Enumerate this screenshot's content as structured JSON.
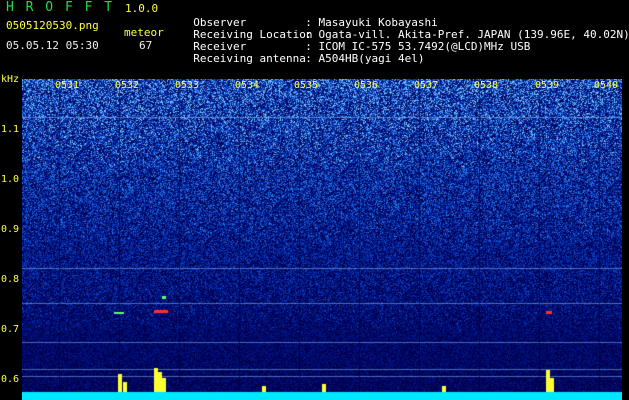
{
  "header": {
    "app_title": "H R O F F T",
    "version": "1.0.0",
    "filename": "0505120530.png",
    "meteor_label": "meteor",
    "datetime": "05.05.12 05:30",
    "meteor_count": "67"
  },
  "meta": [
    {
      "key": "Observer",
      "value": ": Masayuki Kobayashi"
    },
    {
      "key": "Receiving Location",
      "value": ": Ogata-vill. Akita-Pref. JAPAN (139.96E, 40.02N)"
    },
    {
      "key": "Receiver",
      "value": ": ICOM IC-575 53.7492(@LCD)MHz USB"
    },
    {
      "key": "Receiving antenna",
      "value": ": A504HB(yagi 4el)"
    }
  ],
  "axis": {
    "y_unit": "kHz",
    "y_ticks": [
      "1.1",
      "1.0",
      "0.9",
      "0.8",
      "0.7",
      "0.6"
    ],
    "x_ticks": [
      "0531",
      "0532",
      "0533",
      "0534",
      "0535",
      "0536",
      "0537",
      "0538",
      "0539",
      "0540"
    ]
  },
  "colors": {
    "label": "#ffff44",
    "title": "#22dd44",
    "meta": "#ffffff",
    "spectrum_bg": "#00005a"
  }
}
